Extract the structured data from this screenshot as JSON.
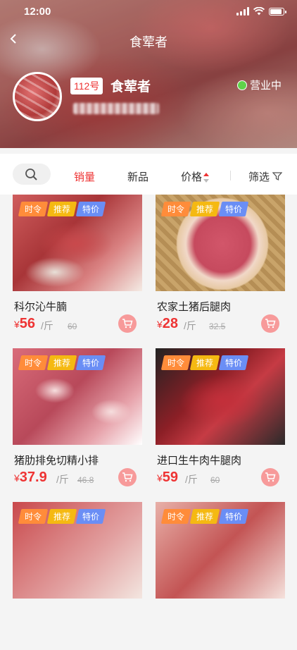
{
  "status_bar": {
    "time": "12:00"
  },
  "nav": {
    "title": "食荤者"
  },
  "shop": {
    "number": "112号",
    "name": "食荤者",
    "status": "营业中"
  },
  "filter": {
    "tabs": [
      {
        "label": "销量",
        "active": true
      },
      {
        "label": "新品",
        "active": false
      },
      {
        "label": "价格",
        "active": false
      },
      {
        "label": "筛选",
        "active": false
      }
    ]
  },
  "products": [
    {
      "name": "科尔沁牛腩",
      "price": "56",
      "unit": "/斤",
      "original_price": "60",
      "tags": [
        "时令",
        "推荐",
        "特价"
      ]
    },
    {
      "name": "农家土猪后腿肉",
      "price": "28",
      "unit": "/斤",
      "original_price": "32.5",
      "tags": [
        "时令",
        "推荐",
        "特价"
      ]
    },
    {
      "name": "猪肋排免切精小排",
      "price": "37.9",
      "unit": "/斤",
      "original_price": "46.8",
      "tags": [
        "时令",
        "推荐",
        "特价"
      ]
    },
    {
      "name": "进口生牛肉牛腿肉",
      "price": "59",
      "unit": "/斤",
      "original_price": "60",
      "tags": [
        "时令",
        "推荐",
        "特价"
      ]
    },
    {
      "tags": [
        "时令",
        "推荐",
        "特价"
      ]
    },
    {
      "tags": [
        "时令",
        "推荐",
        "特价"
      ]
    }
  ],
  "currency_symbol": "¥",
  "colors": {
    "accent": "#e33333",
    "open_status": "#5fd34a",
    "cart_button": "#f79a9a"
  }
}
